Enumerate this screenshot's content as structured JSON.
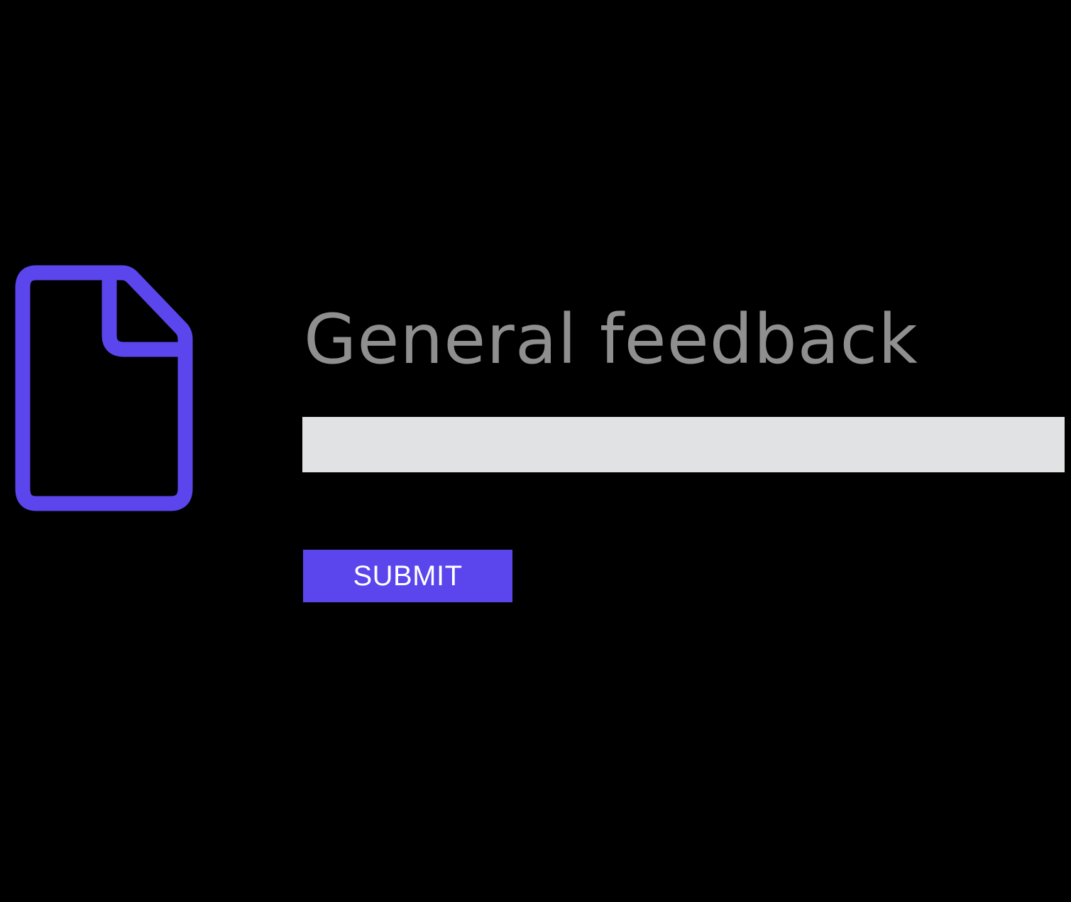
{
  "form": {
    "title": "General feedback",
    "input_value": "",
    "submit_label": "SUBMIT"
  },
  "icons": {
    "document": "document-icon"
  },
  "colors": {
    "background": "#000000",
    "accent": "#5b45ec",
    "title": "#8f8f8f",
    "input_background": "#e1e2e4",
    "button_text": "#ffffff"
  }
}
